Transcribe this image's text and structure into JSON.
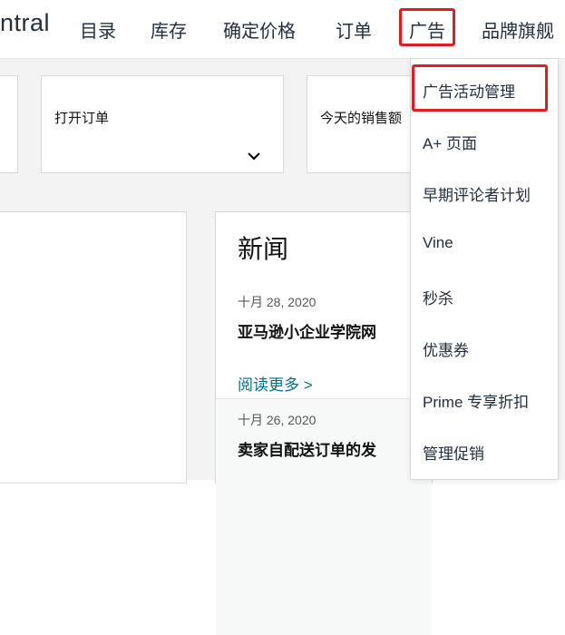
{
  "header": {
    "logo_text": "ntral",
    "nav": [
      {
        "label": "目录"
      },
      {
        "label": "库存"
      },
      {
        "label": "确定价格"
      },
      {
        "label": "订单"
      },
      {
        "label": "广告"
      },
      {
        "label": "品牌旗舰"
      }
    ]
  },
  "widgets": [
    {
      "label": "打开订单"
    },
    {
      "label": "今天的销售额"
    }
  ],
  "news": {
    "title": "新闻",
    "items": [
      {
        "date": "十月 28, 2020",
        "headline": "亚马逊小企业学院网"
      },
      {
        "date": "十月 26, 2020",
        "headline": "卖家自配送订单的发"
      }
    ],
    "read_more": "阅读更多 >"
  },
  "ad_menu": {
    "items": [
      {
        "label": "广告活动管理"
      },
      {
        "label": "A+ 页面"
      },
      {
        "label": "早期评论者计划"
      },
      {
        "label": "Vine"
      },
      {
        "label": "秒杀"
      },
      {
        "label": "优惠券"
      },
      {
        "label": "Prime 专享折扣"
      },
      {
        "label": "管理促销"
      }
    ]
  },
  "colors": {
    "highlight": "#e31b23",
    "link": "#007185",
    "nav_text": "#232f3e"
  }
}
